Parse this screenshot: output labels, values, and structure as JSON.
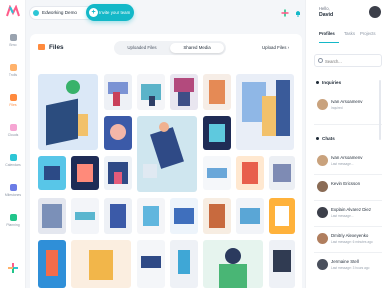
{
  "sidebar": {
    "items": [
      {
        "label": "Brno",
        "icon": "grid-icon",
        "color": "#9aa3af"
      },
      {
        "label": "Trolls",
        "icon": "box-icon",
        "color": "#ffb26b"
      },
      {
        "label": "Files",
        "icon": "folder-icon",
        "color": "#ff8a3d"
      },
      {
        "label": "Clouds",
        "icon": "cloud-icon",
        "color": "#f6a5d3"
      },
      {
        "label": "Calendars",
        "icon": "calendar-icon",
        "color": "#2dc6d6"
      },
      {
        "label": "Milestones",
        "icon": "milestone-icon",
        "color": "#6b7ce6"
      },
      {
        "label": "Planning",
        "icon": "planning-icon",
        "color": "#22c58b"
      }
    ]
  },
  "header": {
    "workspace": "Edworking Demo",
    "invite": "Invite your team",
    "plus": "+"
  },
  "main": {
    "title": "Files",
    "tabs": [
      "Uploaded Files",
      "Shared Media"
    ],
    "active_tab": "Shared Media",
    "uploaded_link": "Upload Files",
    "arrow": "›"
  },
  "user": {
    "greeting": "Hello,",
    "name": "David"
  },
  "rpanel": {
    "tabs": [
      "Profiles",
      "Tasks",
      "Projects"
    ],
    "search_placeholder": "Search...",
    "inquiries": "Inquiries",
    "chats": "Chats",
    "inquiry_people": [
      {
        "name": "Ivan Arsoamenv",
        "status": "Inquired"
      }
    ],
    "chat_people": [
      {
        "name": "Ivan Arsoamenv",
        "status": "Last message..."
      },
      {
        "name": "Kevin Ericsson",
        "status": ""
      },
      {
        "name": "Explain Alvarez Diez",
        "status": "Last message..."
      },
      {
        "name": "Dmitriy Alexeyenko",
        "status": "Last message: 6 minutes ago"
      },
      {
        "name": "Jermaine Stell",
        "status": "Last message: 3 hours ago"
      }
    ]
  },
  "colors": {
    "accent": "#14b8c8",
    "files": "#ff8a3d"
  }
}
